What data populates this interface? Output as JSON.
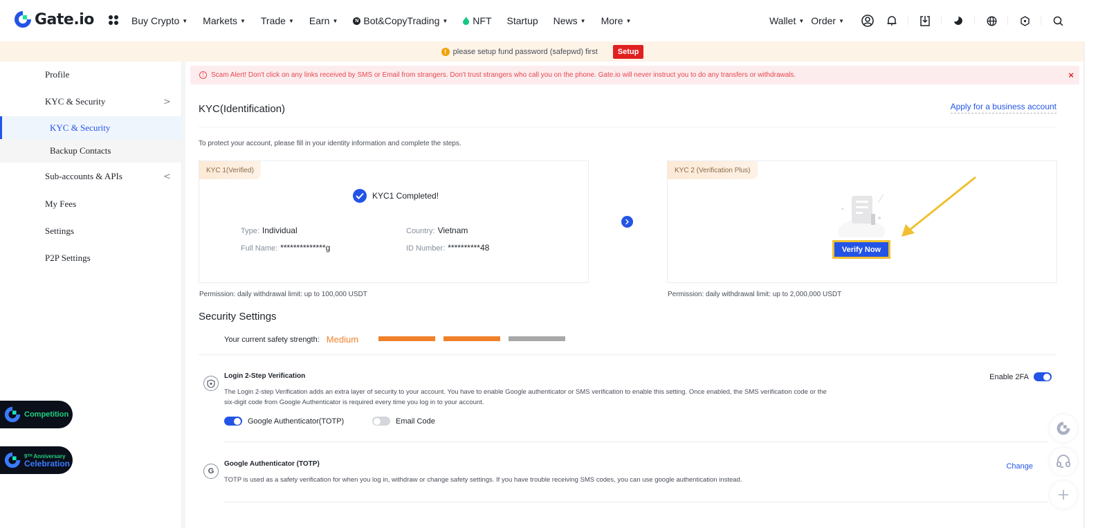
{
  "brand": {
    "name": "Gate.io",
    "accent": "#2354e6"
  },
  "topnav": {
    "items": [
      {
        "label": "Buy Crypto",
        "dropdown": true
      },
      {
        "label": "Markets",
        "dropdown": true
      },
      {
        "label": "Trade",
        "dropdown": true
      },
      {
        "label": "Earn",
        "dropdown": true
      },
      {
        "label": "Bot&CopyTrading",
        "dropdown": true,
        "icon": "bot-icon"
      },
      {
        "label": "NFT",
        "dropdown": false,
        "icon": "flame-icon"
      },
      {
        "label": "Startup",
        "dropdown": false
      },
      {
        "label": "News",
        "dropdown": true
      },
      {
        "label": "More",
        "dropdown": true
      }
    ],
    "right": {
      "wallet": "Wallet",
      "order": "Order",
      "icons": [
        "user-icon",
        "bell-icon",
        "download-icon",
        "theme-icon",
        "globe-icon",
        "settings-icon",
        "search-icon"
      ]
    }
  },
  "notice": {
    "text": "please setup fund password (safepwd) first",
    "button": "Setup"
  },
  "sidebar": {
    "items": [
      {
        "label": "Profile"
      },
      {
        "label": "KYC & Security",
        "chevron": ">"
      },
      {
        "label": "KYC & Security",
        "sub": true,
        "active": true
      },
      {
        "label": "Backup Contacts",
        "sub": true
      },
      {
        "label": "Sub-accounts & APIs",
        "chevron": "<"
      },
      {
        "label": "My Fees"
      },
      {
        "label": "Settings"
      },
      {
        "label": "P2P Settings"
      }
    ]
  },
  "promos": [
    {
      "label": "Competition"
    },
    {
      "label_top": "9ᵀᴴ Anniversary",
      "label_bottom": "Celebration"
    }
  ],
  "scam_alert": {
    "text": "Scam Alert! Don't click on any links received by SMS or Email from strangers. Don't trust strangers who call you on the phone. Gate.io will never instruct you to do any transfers or withdrawals.",
    "close": "×"
  },
  "kyc": {
    "title": "KYC(Identification)",
    "business_link": "Apply for a business account",
    "intro": "To protect your account, please fill in your identity information and complete the steps.",
    "kyc1": {
      "tag": "KYC 1(Verified)",
      "status": "KYC1 Completed!",
      "type_label": "Type:",
      "type_value": "Individual",
      "country_label": "Country:",
      "country_value": "Vietnam",
      "name_label": "Full Name:",
      "name_value": "**************g",
      "id_label": "ID Number:",
      "id_value": "**********48",
      "permission": "Permission: daily withdrawal limit: up to 100,000 USDT"
    },
    "kyc2": {
      "tag": "KYC 2 (Verification Plus)",
      "button": "Verify Now",
      "permission": "Permission: daily withdrawal limit: up to 2,000,000 USDT"
    }
  },
  "security": {
    "title": "Security Settings",
    "strength_label": "Your current safety strength:",
    "strength_value": "Medium",
    "strength_level": 2,
    "strength_max": 3,
    "colors": {
      "filled": "#f0812a",
      "empty": "#a8a8a8"
    },
    "login2fa": {
      "title": "Login 2-Step Verification",
      "desc": "The Login 2-step Verification adds an extra layer of security to your account. You have to enable Google authenticator or SMS verification to enable this setting. Once enabled, the SMS verification code or the six-digit code from Google Authenticator is required every time you log in to your account.",
      "enable_label": "Enable 2FA",
      "enable_on": true,
      "options": [
        {
          "label": "Google Authenticator(TOTP)",
          "on": true
        },
        {
          "label": "Email Code",
          "on": false
        }
      ]
    },
    "totp": {
      "title": "Google Authenticator (TOTP)",
      "desc": "TOTP is used as a safety verification for when you log in, withdraw or change safety settings. If you have trouble receiving SMS codes, you can use google authentication instead.",
      "action": "Change"
    }
  },
  "float_buttons": [
    "gate-logo-icon",
    "headset-icon",
    "plus-icon"
  ]
}
